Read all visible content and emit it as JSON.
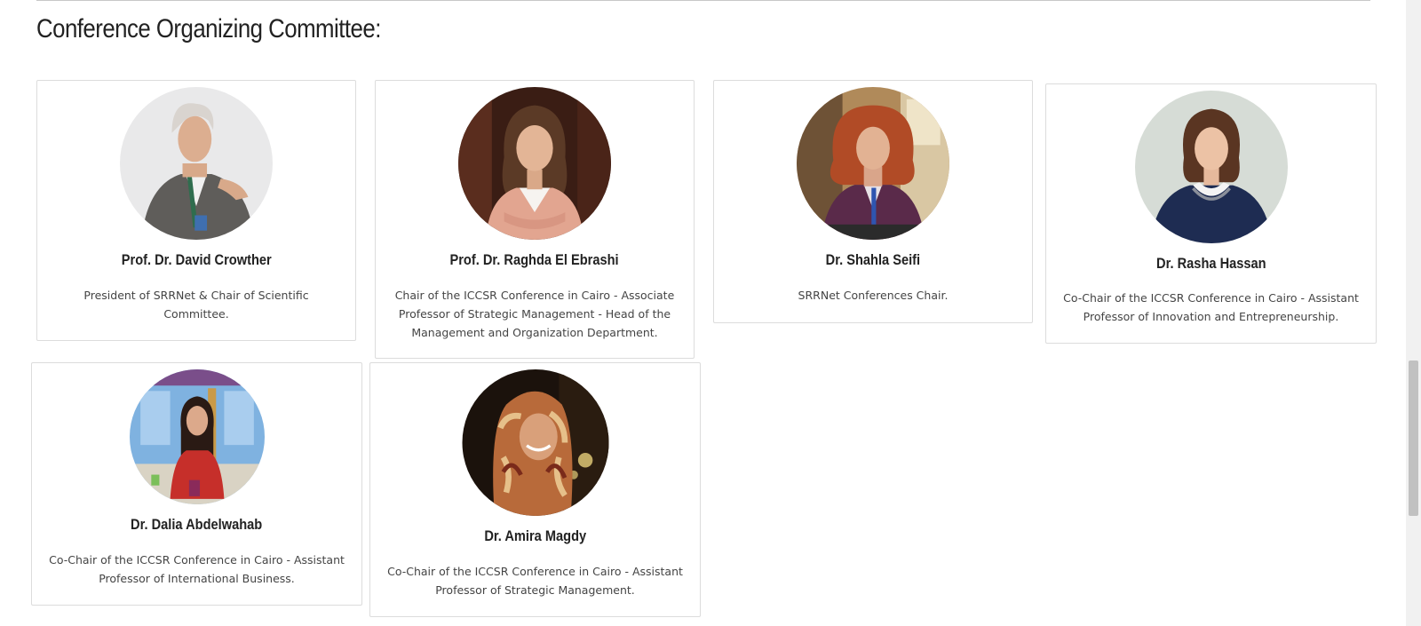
{
  "section": {
    "title": "Conference Organizing Committee:"
  },
  "members": [
    {
      "name": "Prof. Dr. David Crowther",
      "role": "President of SRRNet & Chair of Scientific Committee."
    },
    {
      "name": "Prof. Dr. Raghda El Ebrashi",
      "role": "Chair of the ICCSR Conference in Cairo - Associate Professor of Strategic Management - Head of the Management and Organization Department."
    },
    {
      "name": "Dr. Shahla Seifi",
      "role": "SRRNet Conferences Chair."
    },
    {
      "name": "Dr. Rasha Hassan",
      "role": "Co-Chair of the ICCSR Conference in Cairo - Assistant Professor of Innovation and Entrepreneurship."
    },
    {
      "name": "Dr. Dalia Abdelwahab",
      "role": "Co-Chair of the ICCSR Conference in Cairo - Assistant Professor of International Business."
    },
    {
      "name": "Dr. Amira Magdy",
      "role": "Co-Chair of the ICCSR Conference in Cairo - Assistant Professor of Strategic Management."
    }
  ]
}
